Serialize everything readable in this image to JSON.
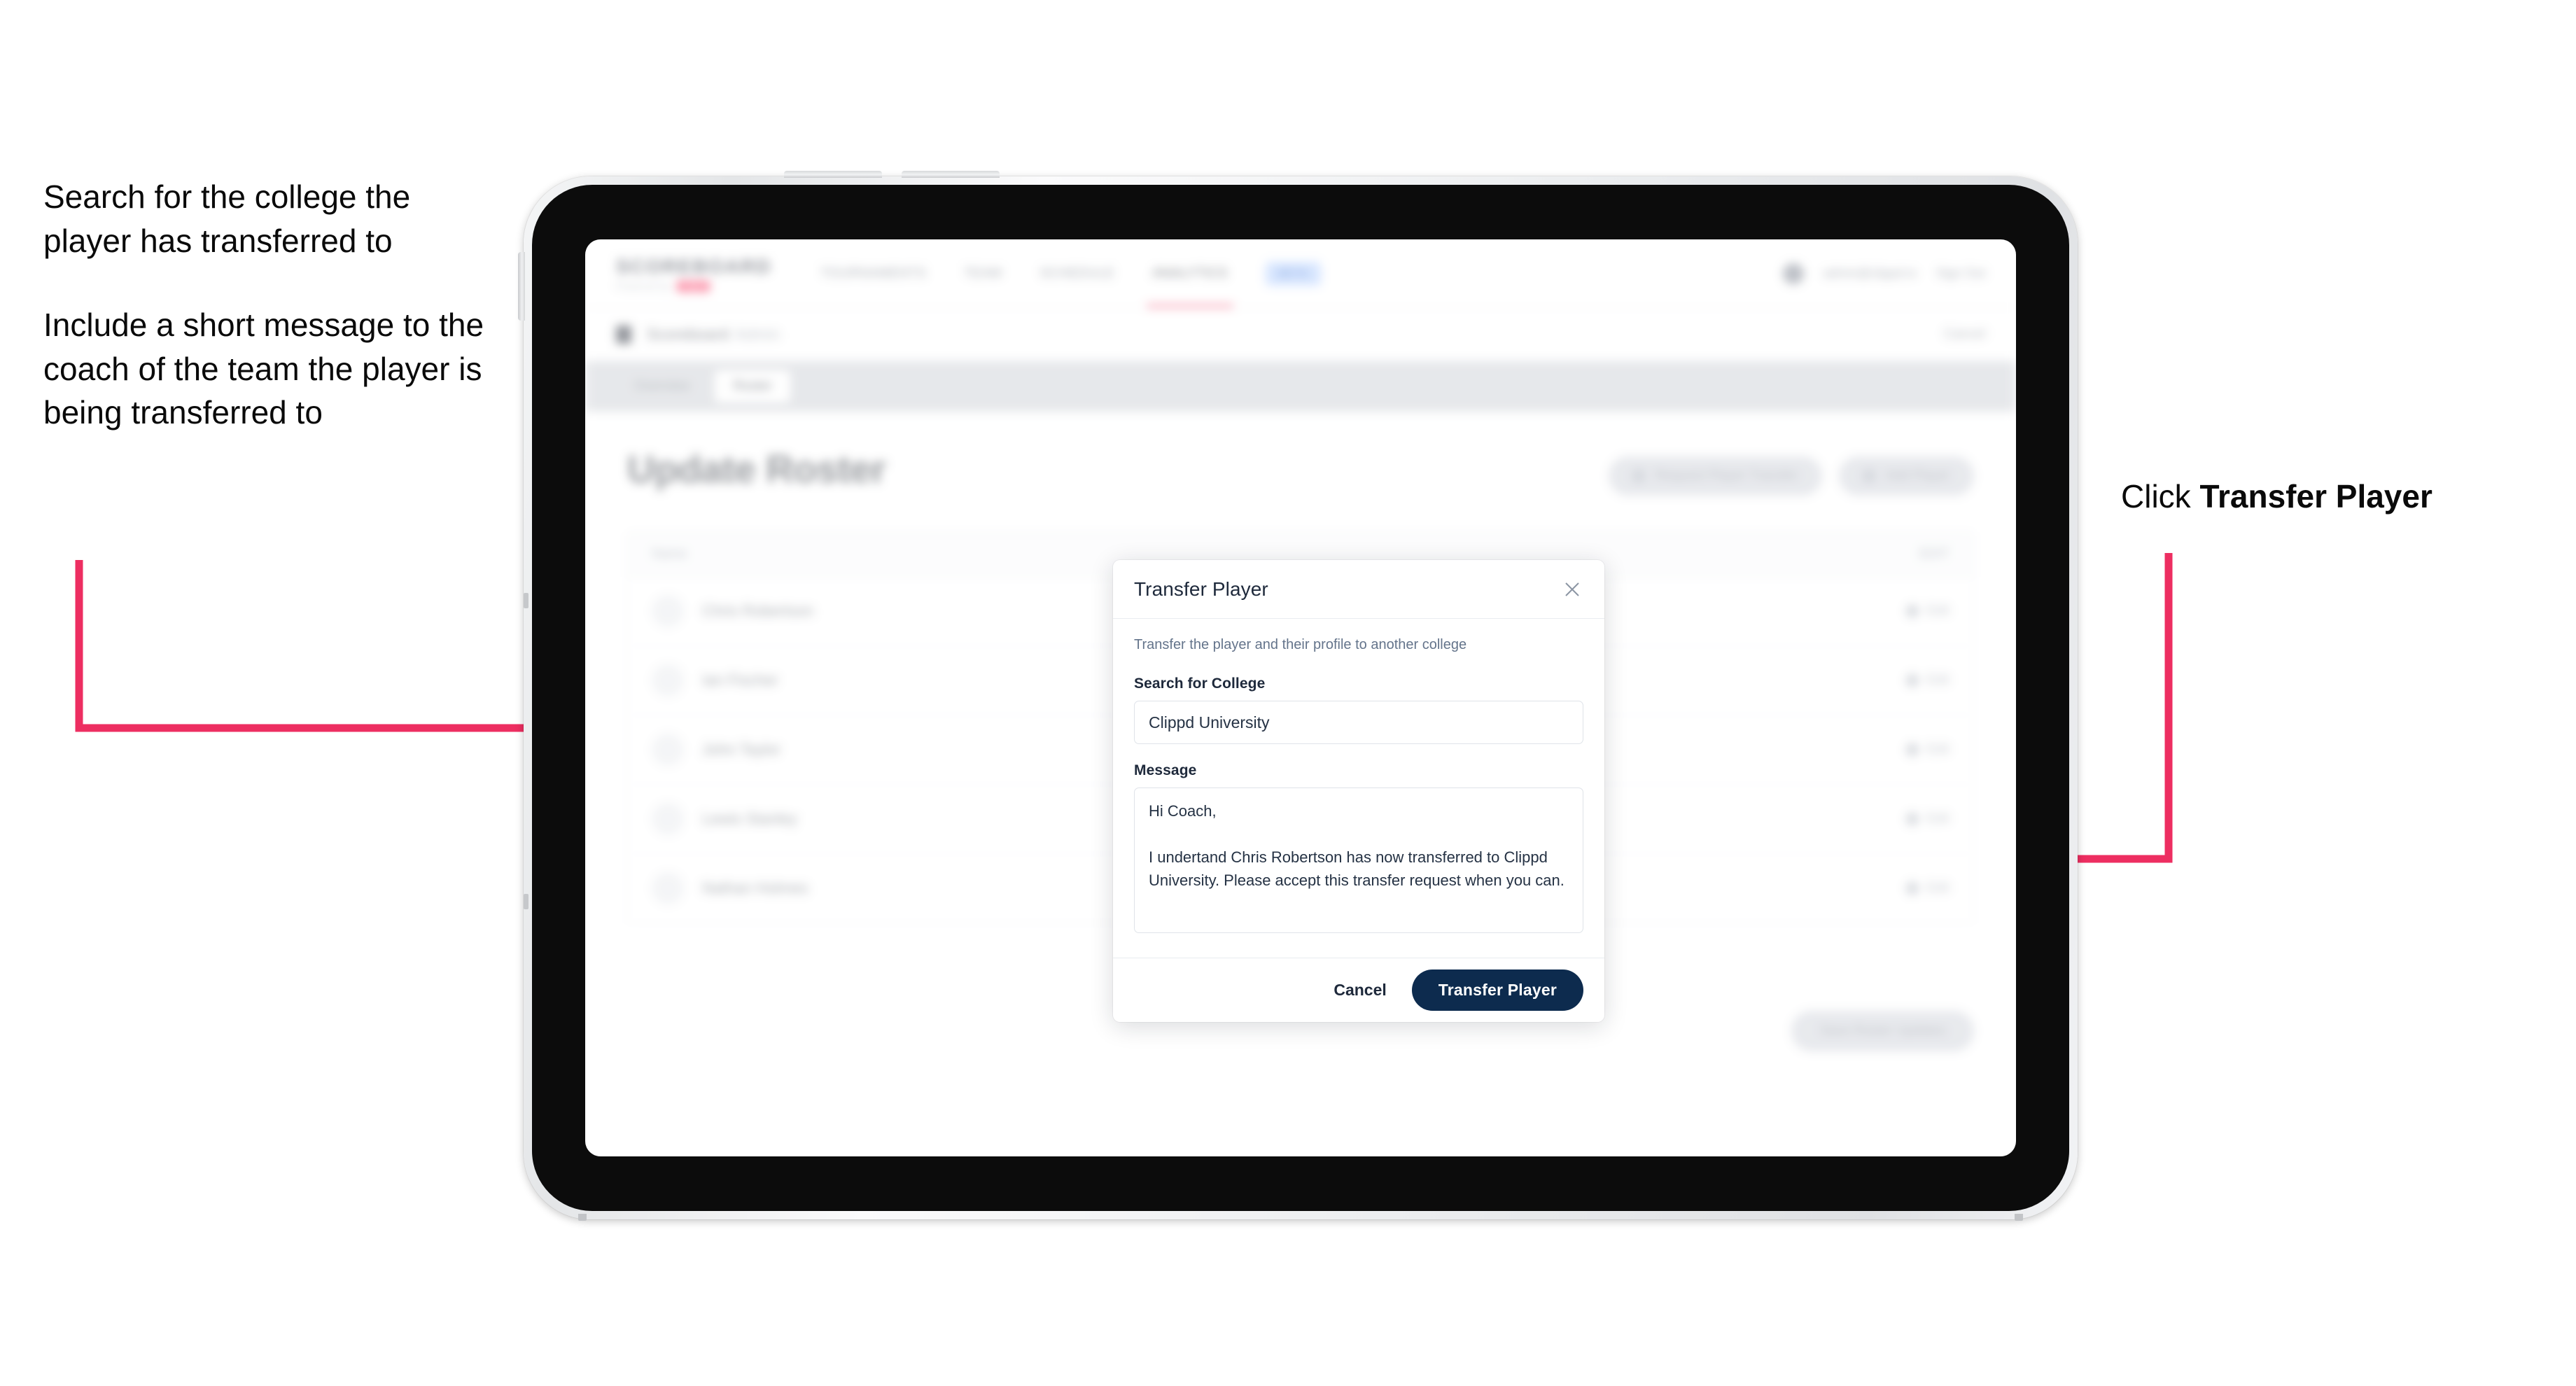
{
  "annotations": {
    "left": [
      "Search for the college the player has transferred to",
      "Include a short message to the coach of the team the player is being transferred to"
    ],
    "right_prefix": "Click ",
    "right_bold": "Transfer Player",
    "arrow_color": "#ED2E61"
  },
  "app": {
    "brand": {
      "word": "SCOREBOARD",
      "sub": "Powered by",
      "pill": "clippd"
    },
    "nav": [
      {
        "label": "TOURNAMENTS",
        "active": false
      },
      {
        "label": "TEAM",
        "active": false
      },
      {
        "label": "SCHEDULE",
        "active": false
      },
      {
        "label": "ANALYTICS",
        "active": true
      },
      {
        "label": "BETA",
        "badge": true
      }
    ],
    "header_right": {
      "account": "admin@clippd.io",
      "signout": "Sign Out"
    },
    "subbar": {
      "title": "Scoreboard",
      "muted": "Admin",
      "right": "Cancel"
    },
    "tabs": [
      {
        "label": "Overview",
        "active": false
      },
      {
        "label": "Roster",
        "active": true
      }
    ],
    "page_title": "Update Roster",
    "head_actions": [
      {
        "label": "Request Player Transfer",
        "icon": "transfer-icon"
      },
      {
        "label": "Add Player",
        "icon": "plus-icon"
      }
    ],
    "roster": {
      "columns": {
        "name": "Name",
        "edit": "EDIT"
      },
      "rows": [
        {
          "name": "Chris Robertson",
          "edit": "Edit"
        },
        {
          "name": "Ian Fischer",
          "edit": "Edit"
        },
        {
          "name": "John Taylor",
          "edit": "Edit"
        },
        {
          "name": "Lewis Stanley",
          "edit": "Edit"
        },
        {
          "name": "Nathan Holmes",
          "edit": "Edit"
        }
      ]
    },
    "bottom_cta": "Save Roster Updates"
  },
  "modal": {
    "title": "Transfer Player",
    "close_icon": "close-icon",
    "subtitle": "Transfer the player and their profile to another college",
    "college_field": {
      "label": "Search for College",
      "value": "Clippd University",
      "placeholder": "Search for College"
    },
    "message_field": {
      "label": "Message",
      "value": "Hi Coach,\n\nI undertand Chris Robertson has now transferred to Clippd University. Please accept this transfer request when you can.",
      "placeholder": "Message"
    },
    "cancel_label": "Cancel",
    "submit_label": "Transfer Player",
    "submit_color": "#0d2b4e"
  }
}
